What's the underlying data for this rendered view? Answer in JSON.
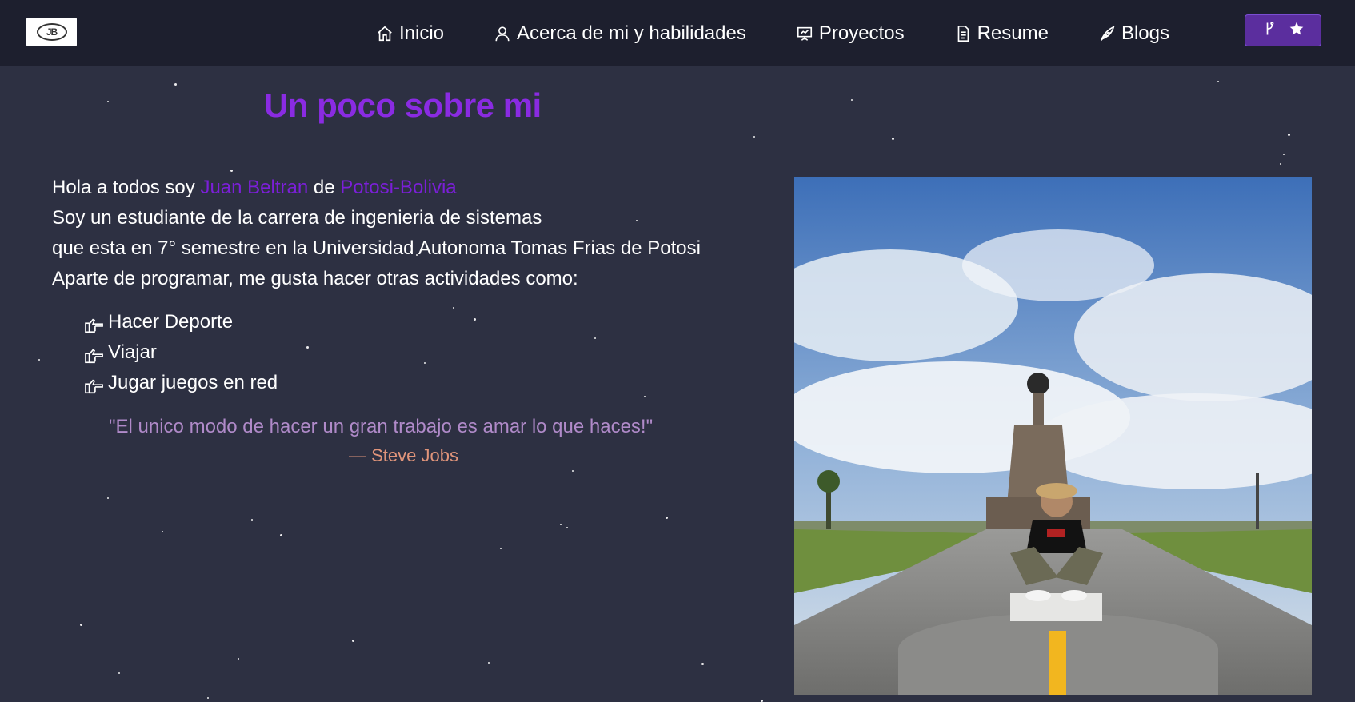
{
  "nav": {
    "logo_text": "JB",
    "items": [
      {
        "label": "Inicio",
        "icon": "home-icon"
      },
      {
        "label": "Acerca de mi y habilidades",
        "icon": "user-icon"
      },
      {
        "label": "Proyectos",
        "icon": "presentation-icon"
      },
      {
        "label": "Resume",
        "icon": "document-icon"
      },
      {
        "label": "Blogs",
        "icon": "feather-icon"
      }
    ],
    "fork_button": {
      "icons": [
        "git-fork-icon",
        "star-icon"
      ]
    }
  },
  "main": {
    "title": "Un poco sobre mi",
    "intro": {
      "greeting_prefix": "Hola a todos soy ",
      "name": "Juan Beltran",
      "connector": " de ",
      "place": "Potosi-Bolivia",
      "line2": "Soy un estudiante de la carrera de ingenieria de sistemas",
      "line3": "que esta en 7° semestre en la Universidad Autonoma Tomas Frias de Potosi",
      "line4": "Aparte de programar, me gusta hacer otras actividades como:"
    },
    "activities": [
      "Hacer Deporte",
      "Viajar",
      "Jugar juegos en red"
    ],
    "quote": "\"El unico modo de hacer un gran trabajo es amar lo que haces!\"",
    "quote_author": "— Steve Jobs"
  },
  "colors": {
    "background": "#2d3042",
    "navbar": "#1d1f2e",
    "title_accent": "#8a2be2",
    "name_accent": "#7b1fd8",
    "quote": "#b08ac9",
    "author": "#e0947a",
    "fork_button": "#5b2e9e"
  },
  "photo": {
    "icon": "profile-photo-monument"
  }
}
